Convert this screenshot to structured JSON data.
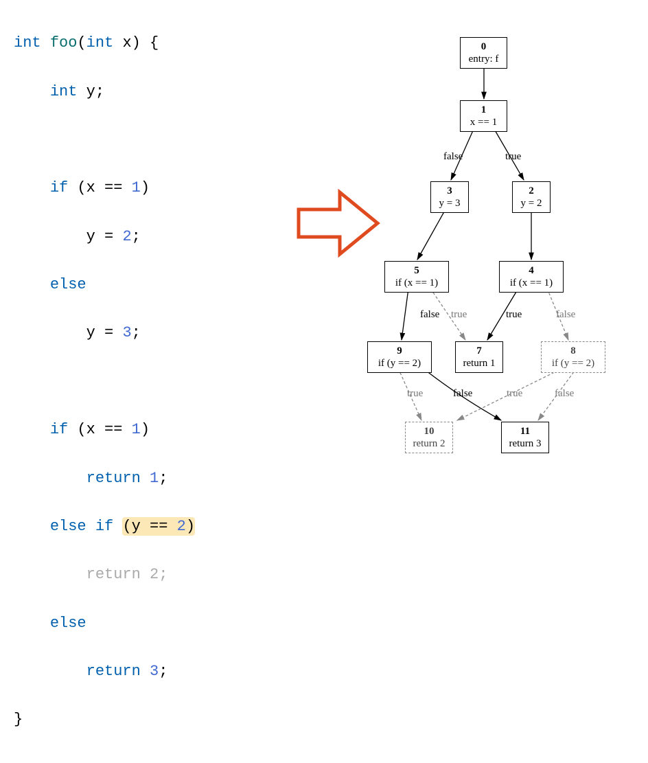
{
  "code": {
    "l1_type1": "int",
    "l1_fn": "foo",
    "l1_type2": "int",
    "l1_var": "x",
    "l1_tail": ") {",
    "l2_type": "int",
    "l2_rest": " y;",
    "l3_kw": "if",
    "l3_cond_pre": " (x == ",
    "l3_num": "1",
    "l3_cond_post": ")",
    "l4_pre": "        y = ",
    "l4_num": "2",
    "l4_post": ";",
    "l5_kw": "else",
    "l6_pre": "        y = ",
    "l6_num": "3",
    "l6_post": ";",
    "l7_kw": "if",
    "l7_cond_pre": " (x == ",
    "l7_num": "1",
    "l7_cond_post": ")",
    "l8_kw": "return",
    "l8_sp": " ",
    "l8_num": "1",
    "l8_post": ";",
    "l9_kw1": "else",
    "l9_kw2": "if",
    "l9_sp": " ",
    "l9_hl_pre": "(y == ",
    "l9_hl_num": "2",
    "l9_hl_post": ")",
    "l10_kw": "return",
    "l10_sp": " ",
    "l10_num": "2",
    "l10_post": ";",
    "l11_kw": "else",
    "l12_kw": "return",
    "l12_sp": " ",
    "l12_num": "3",
    "l12_post": ";",
    "l13": "}"
  },
  "graph": {
    "n0_id": "0",
    "n0_text": "entry: f",
    "n1_id": "1",
    "n1_text": "x == 1",
    "n2_id": "2",
    "n2_text": "y = 2",
    "n3_id": "3",
    "n3_text": "y = 3",
    "n4_id": "4",
    "n4_text": "if (x == 1)",
    "n5_id": "5",
    "n5_text": "if (x == 1)",
    "n7_id": "7",
    "n7_text": "return 1",
    "n8_id": "8",
    "n8_text": "if (y == 2)",
    "n9_id": "9",
    "n9_text": "if (y == 2)",
    "n10_id": "10",
    "n10_text": "return 2",
    "n11_id": "11",
    "n11_text": "return 3",
    "lbl_false": "false",
    "lbl_true": "true"
  }
}
